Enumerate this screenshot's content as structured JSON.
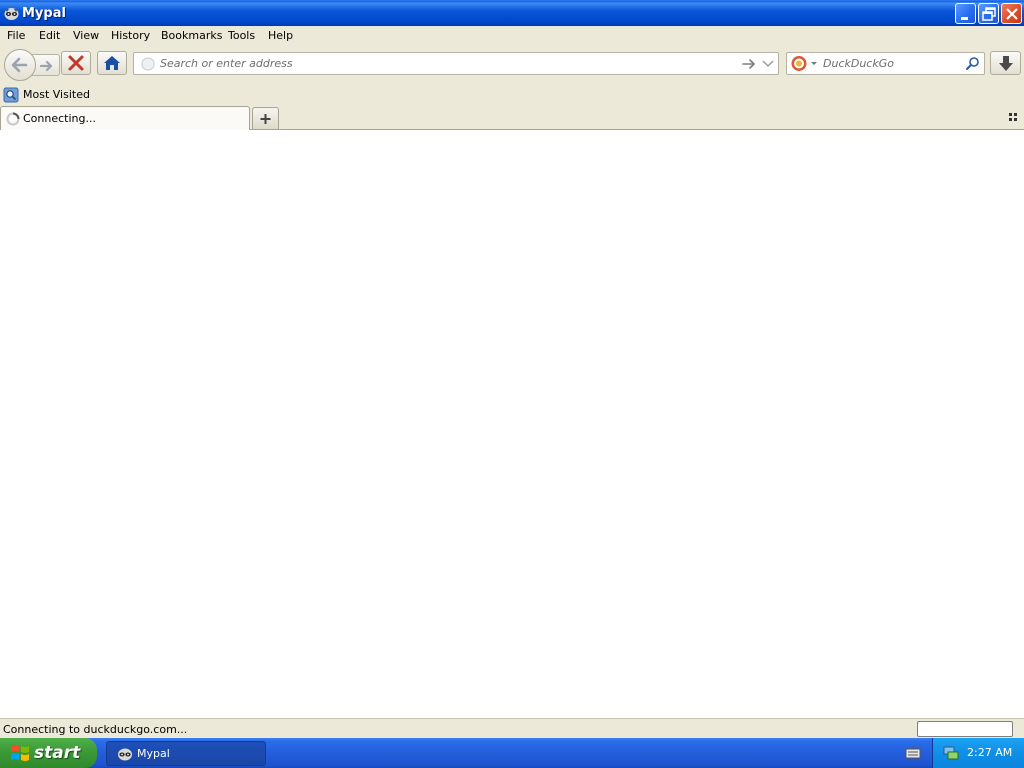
{
  "window": {
    "title": "Mypal",
    "app_icon": "mypal-raccoon-icon",
    "controls": {
      "minimize_icon": "minimize-icon",
      "restore_icon": "restore-icon",
      "close_icon": "close-icon"
    }
  },
  "menubar": {
    "items": [
      {
        "label": "File",
        "accesskey": "F"
      },
      {
        "label": "Edit",
        "accesskey": "E"
      },
      {
        "label": "View",
        "accesskey": "V"
      },
      {
        "label": "History",
        "accesskey": "H"
      },
      {
        "label": "Bookmarks",
        "accesskey": "B"
      },
      {
        "label": "Tools",
        "accesskey": "T"
      },
      {
        "label": "Help",
        "accesskey": "H"
      }
    ]
  },
  "navbar": {
    "back_icon": "back-arrow-icon",
    "forward_icon": "forward-arrow-icon",
    "stop_icon": "stop-x-icon",
    "home_icon": "home-icon",
    "address": {
      "value": "",
      "placeholder": "Search or enter address"
    },
    "go_icon": "go-arrow-icon",
    "dropdown_icon": "chevron-down-icon",
    "search": {
      "value": "",
      "placeholder": "DuckDuckGo",
      "engine_icon": "duckduckgo-icon"
    },
    "downloads_icon": "download-arrow-icon"
  },
  "bookmarks_toolbar": {
    "items": [
      {
        "label": "Most Visited",
        "icon": "most-visited-icon"
      }
    ]
  },
  "tabs": [
    {
      "label": "Connecting...",
      "loading": true,
      "icon": "throbber-icon"
    }
  ],
  "new_tab_icon": "plus-icon",
  "tab_list_icon": "grid-icon",
  "status": {
    "text": "Connecting to duckduckgo.com..."
  },
  "taskbar": {
    "start_label": "start",
    "items": [
      {
        "label": "Mypal",
        "icon": "mypal-raccoon-icon"
      }
    ],
    "tray": {
      "clock": "2:27 AM",
      "keyboard_icon": "keyboard-icon",
      "network_icon": "network-icon"
    }
  },
  "colors": {
    "titlebar_blue": "#0a55d8",
    "chrome_beige": "#ece9d8",
    "start_green": "#3c9a38",
    "tray_blue": "#0f8fe6",
    "stop_red": "#c0392b",
    "home_blue": "#1c4ea8"
  }
}
